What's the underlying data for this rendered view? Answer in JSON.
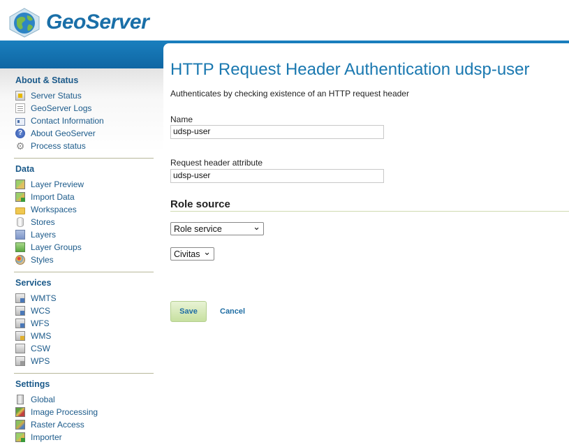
{
  "app": {
    "name": "GeoServer"
  },
  "sidebar": {
    "sections": [
      {
        "title": "About & Status",
        "items": [
          {
            "label": "Server Status",
            "icon": "server-status-icon"
          },
          {
            "label": "GeoServer Logs",
            "icon": "logs-icon"
          },
          {
            "label": "Contact Information",
            "icon": "contact-card-icon"
          },
          {
            "label": "About GeoServer",
            "icon": "info-icon"
          },
          {
            "label": "Process status",
            "icon": "gear-icon"
          }
        ]
      },
      {
        "title": "Data",
        "items": [
          {
            "label": "Layer Preview",
            "icon": "map-preview-icon"
          },
          {
            "label": "Import Data",
            "icon": "import-map-icon"
          },
          {
            "label": "Workspaces",
            "icon": "folder-icon"
          },
          {
            "label": "Stores",
            "icon": "database-icon"
          },
          {
            "label": "Layers",
            "icon": "layer-icon"
          },
          {
            "label": "Layer Groups",
            "icon": "layer-group-icon"
          },
          {
            "label": "Styles",
            "icon": "palette-icon"
          }
        ]
      },
      {
        "title": "Services",
        "items": [
          {
            "label": "WMTS",
            "icon": "service-icon"
          },
          {
            "label": "WCS",
            "icon": "service-icon"
          },
          {
            "label": "WFS",
            "icon": "service-icon"
          },
          {
            "label": "WMS",
            "icon": "service-icon"
          },
          {
            "label": "CSW",
            "icon": "service-icon"
          },
          {
            "label": "WPS",
            "icon": "service-icon"
          }
        ]
      },
      {
        "title": "Settings",
        "items": [
          {
            "label": "Global",
            "icon": "server-icon"
          },
          {
            "label": "Image Processing",
            "icon": "image-processing-icon"
          },
          {
            "label": "Raster Access",
            "icon": "raster-icon"
          },
          {
            "label": "Importer",
            "icon": "import-map-icon"
          }
        ]
      }
    ]
  },
  "main": {
    "title": "HTTP Request Header Authentication udsp-user",
    "description": "Authenticates by checking existence of an HTTP request header",
    "name_label": "Name",
    "name_value": "udsp-user",
    "header_attr_label": "Request header attribute",
    "header_attr_value": "udsp-user",
    "role_source_heading": "Role source",
    "role_source_select": "Role service",
    "role_service_select": "Civitas",
    "save_label": "Save",
    "cancel_label": "Cancel"
  }
}
